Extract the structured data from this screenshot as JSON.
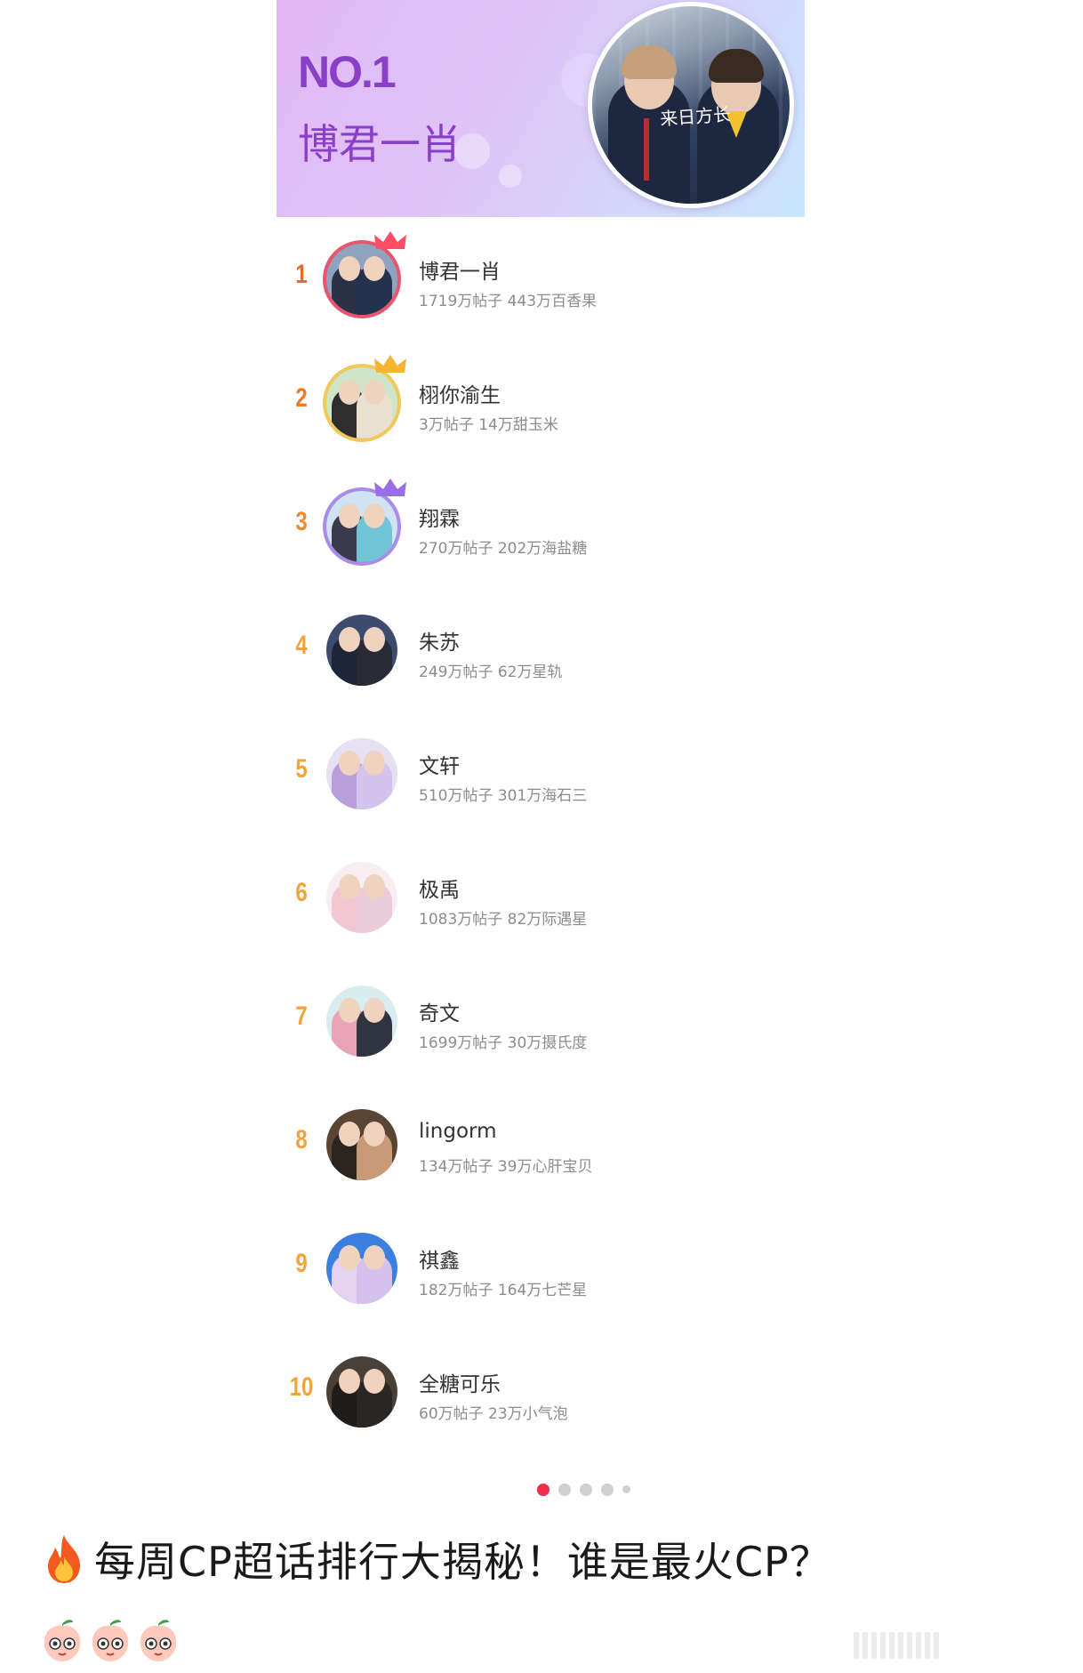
{
  "banner": {
    "rank": "NO.1",
    "name": "博君一肖",
    "avatar_caption": "来日方长"
  },
  "items": [
    {
      "rank": "1",
      "name": "博君一肖",
      "stats": "1719万帖子 443万百香果",
      "rank_color": "#e86a2b",
      "ring": "#e8566d",
      "crown": "#ff4d64",
      "bg": "#8fa2be",
      "c1": "#2a3148",
      "c2": "#24324d"
    },
    {
      "rank": "2",
      "name": "栩你渝生",
      "stats": "3万帖子 14万甜玉米",
      "rank_color": "#ee7a2c",
      "ring": "#f2c85c",
      "crown": "#f5b532",
      "bg": "#cfe5c8",
      "c1": "#2e2e2e",
      "c2": "#e8e0d0"
    },
    {
      "rank": "3",
      "name": "翔霖",
      "stats": "270万帖子 202万海盐糖",
      "rank_color": "#f08a30",
      "ring": "#a98be8",
      "crown": "#9a6ee6",
      "bg": "#cfe3f2",
      "c1": "#3a3a4a",
      "c2": "#70c4d6"
    },
    {
      "rank": "4",
      "name": "朱苏",
      "stats": "249万帖子 62万星轨",
      "rank_color": "#f3a33c",
      "ring": "",
      "crown": "",
      "bg": "#3d4c6e",
      "c1": "#1e2538",
      "c2": "#2a2a36"
    },
    {
      "rank": "5",
      "name": "文轩",
      "stats": "510万帖子 301万海石三",
      "rank_color": "#f3a33c",
      "ring": "",
      "crown": "",
      "bg": "#e7dff2",
      "c1": "#b89fdc",
      "c2": "#d4c3ec"
    },
    {
      "rank": "6",
      "name": "极禹",
      "stats": "1083万帖子 82万际遇星",
      "rank_color": "#f3a33c",
      "ring": "",
      "crown": "",
      "bg": "#f8eef2",
      "c1": "#f2c7d3",
      "c2": "#eacbd9"
    },
    {
      "rank": "7",
      "name": "奇文",
      "stats": "1699万帖子 30万摄氏度",
      "rank_color": "#f3a33c",
      "ring": "",
      "crown": "",
      "bg": "#d9ecf0",
      "c1": "#e8a4b6",
      "c2": "#2e3440"
    },
    {
      "rank": "8",
      "name": "lingorm",
      "stats": "134万帖子 39万心肝宝贝",
      "rank_color": "#f3a33c",
      "ring": "",
      "crown": "",
      "bg": "#5a4434",
      "c1": "#2c241e",
      "c2": "#c89a78"
    },
    {
      "rank": "9",
      "name": "祺鑫",
      "stats": "182万帖子 164万七芒星",
      "rank_color": "#f3a33c",
      "ring": "",
      "crown": "",
      "bg": "#3b7fe0",
      "c1": "#e6d3f2",
      "c2": "#d6c0ee"
    },
    {
      "rank": "10",
      "name": "全糖可乐",
      "stats": "60万帖子 23万小气泡",
      "rank_color": "#f3a33c",
      "ring": "",
      "crown": "",
      "bg": "#4a4038",
      "c1": "#1f1c1a",
      "c2": "#2a2624"
    }
  ],
  "pager": {
    "count": 5,
    "active": 0
  },
  "caption": {
    "text": "每周CP超话排行大揭秘！谁是最火CP？",
    "leading_icon": "fire-icon",
    "trailing_icons": [
      "peach-icon",
      "peach-icon",
      "peach-icon"
    ]
  }
}
